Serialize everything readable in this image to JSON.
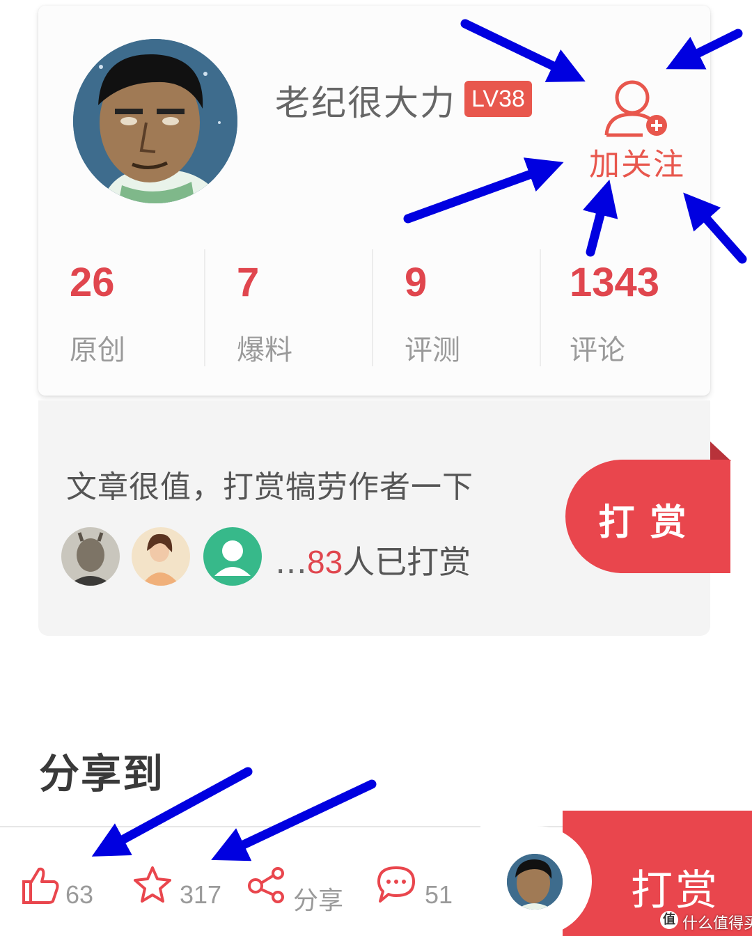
{
  "profile": {
    "username": "老纪很大力",
    "level": "LV38",
    "follow_label": "加关注",
    "stats": [
      {
        "value": "26",
        "label": "原创"
      },
      {
        "value": "7",
        "label": "爆料"
      },
      {
        "value": "9",
        "label": "评测"
      },
      {
        "value": "1343",
        "label": "评论"
      }
    ]
  },
  "reward": {
    "prompt": "文章很值，打赏犒劳作者一下",
    "ellipsis": "…",
    "donor_count": "83",
    "donor_suffix": "人已打赏",
    "button_label": "打赏"
  },
  "share": {
    "heading": "分享到"
  },
  "bottom_bar": {
    "likes": "63",
    "favorites": "317",
    "share_label": "分享",
    "comments": "51",
    "reward_label": "打赏"
  },
  "watermark": {
    "text": "什么值得买"
  },
  "colors": {
    "accent_red": "#e9464d",
    "stat_red": "#e0464e",
    "annotation_blue": "#0000e0"
  },
  "icons": [
    "follow-user-plus-icon",
    "like-thumb-icon",
    "favorite-star-icon",
    "share-nodes-icon",
    "comment-bubble-icon"
  ]
}
